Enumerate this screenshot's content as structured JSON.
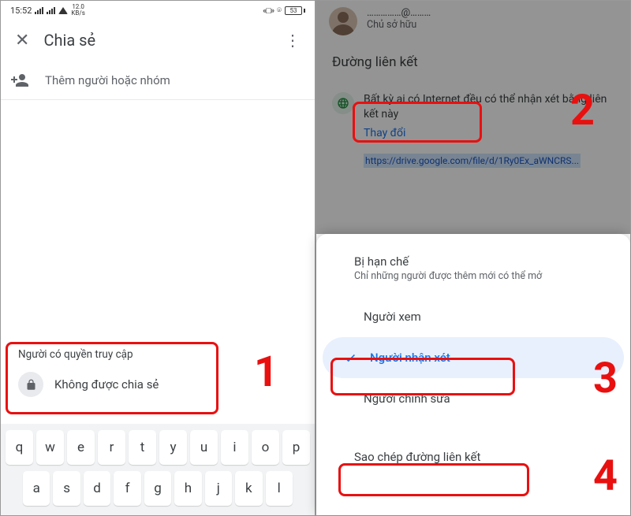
{
  "status": {
    "time": "15:52",
    "kb_speed_top": "12.0",
    "kb_speed_bot": "KB/s",
    "battery": "53"
  },
  "left": {
    "title": "Chia sẻ",
    "add_placeholder": "Thêm người hoặc nhóm",
    "access_title": "Người có quyền truy cập",
    "not_shared": "Không được chia sẻ",
    "marker1": "1"
  },
  "right": {
    "owner_role": "Chủ sở hữu",
    "section_link": "Đường liên kết",
    "link_desc": "Bất kỳ ai có Internet đều có thể nhận xét bằng liên kết này",
    "change": "Thay đổi",
    "url": "https://drive.google.com/file/d/1Ry0Ex_aWNCRS...",
    "restricted": "Bị hạn chế",
    "restricted_sub": "Chỉ những người được thêm mới có thể mở",
    "viewer": "Người xem",
    "commenter": "Người nhận xét",
    "editor": "Người chỉnh sửa",
    "copy_link": "Sao chép đường liên kết",
    "marker2": "2",
    "marker3": "3",
    "marker4": "4"
  },
  "kbd": {
    "r1": [
      "q",
      "w",
      "e",
      "r",
      "t",
      "y",
      "u",
      "i",
      "o",
      "p"
    ],
    "r2": [
      "a",
      "s",
      "d",
      "f",
      "g",
      "h",
      "j",
      "k",
      "l"
    ]
  }
}
